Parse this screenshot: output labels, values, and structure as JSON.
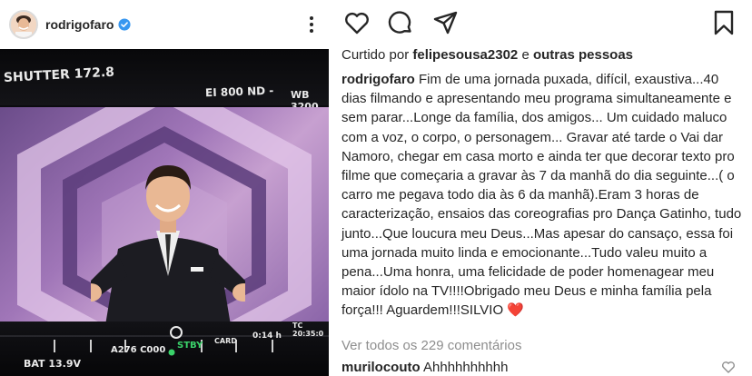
{
  "post": {
    "username": "rodrigofaro",
    "more_label": "•••"
  },
  "photo": {
    "shutter": "SHUTTER 172.8",
    "ei": "EI 800  ND -",
    "wb": "WB 3200",
    "bat": "BAT 13.9V",
    "lens": "A276  C000",
    "stby": "STBY",
    "card": "CARD",
    "time": "0:14 h",
    "tc": "TC 20:35:0"
  },
  "likes": {
    "prefix": "Curtido por ",
    "user": "felipesousa2302",
    "middle": " e ",
    "others": "outras pessoas"
  },
  "caption": {
    "user": "rodrigofaro",
    "text": "Fim de uma jornada puxada, difícil, exaustiva...40 dias filmando e apresentando meu programa simultaneamente e sem parar...Longe da família, dos amigos... Um cuidado maluco com a voz, o corpo, o personagem... Gravar até tarde o  Vai dar Namoro, chegar em casa morto  e ainda ter que decorar texto pro filme que começaria a gravar às 7 da manhã do dia seguinte...( o carro me pegava todo dia às 6 da manhã).Eram 3 horas de caracterização, ensaios das coreografias pro Dança Gatinho, tudo junto...Que loucura meu Deus...Mas apesar do cansaço, essa foi uma jornada muito linda e emocionante...Tudo valeu muito a pena...Uma honra, uma felicidade de poder homenagear meu maior ídolo na TV!!!!Obrigado meu Deus e minha família pela força!!! Aguardem!!!SILVIO",
    "emoji": "❤️"
  },
  "comments": {
    "view_all": "Ver todos os 229 comentários",
    "first": {
      "user": "murilocouto",
      "text": "Ahhhhhhhhhh"
    }
  },
  "icons": {
    "like": "heart-outline-icon",
    "comment": "speech-bubble-icon",
    "share": "paper-plane-icon",
    "save": "bookmark-icon",
    "verified": "verified-badge-icon"
  },
  "colors": {
    "verified_blue": "#3897f0",
    "heart_red": "#d0021b",
    "stby_green": "#3ad26a"
  }
}
